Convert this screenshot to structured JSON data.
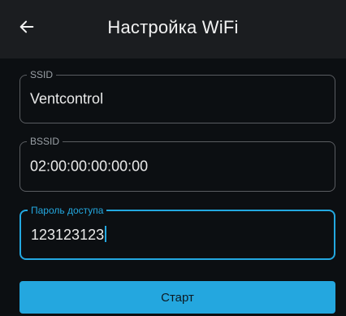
{
  "header": {
    "title": "Настройка WiFi",
    "back_icon": "arrow-left-icon"
  },
  "form": {
    "ssid": {
      "label": "SSID",
      "value": "Ventcontrol"
    },
    "bssid": {
      "label": "BSSID",
      "value": "02:00:00:00:00:00"
    },
    "password": {
      "label": "Пароль доступа",
      "value": "123123123",
      "focused": true
    }
  },
  "actions": {
    "start_label": "Старт"
  },
  "colors": {
    "accent": "#23a8e0",
    "background": "#0c0f12",
    "appbar": "#1b1d20"
  }
}
